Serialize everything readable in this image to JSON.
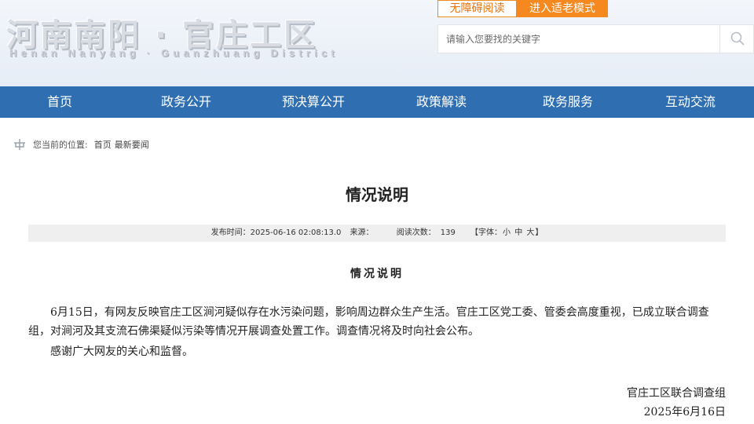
{
  "header": {
    "logo_cn": "河南南阳 · 官庄工区",
    "logo_en": "Henan Nanyang · Guanzhuang District",
    "accessibility_label": "无障碍阅读",
    "elder_mode_label": "进入适老模式",
    "search": {
      "placeholder": "请输入您要找的关键字"
    }
  },
  "nav": {
    "items": [
      {
        "label": "首页"
      },
      {
        "label": "政务公开"
      },
      {
        "label": "预决算公开"
      },
      {
        "label": "政策解读"
      },
      {
        "label": "政务服务"
      },
      {
        "label": "互动交流"
      }
    ]
  },
  "breadcrumb": {
    "prefix": "您当前的位置:",
    "items": [
      "首页",
      "最新要闻"
    ]
  },
  "article": {
    "title": "情况说明",
    "meta": {
      "publish_label": "发布时间：",
      "publish_time": "2025-06-16 02:08:13.0",
      "source_label": "来源：",
      "source": "",
      "views_label": "阅读次数：",
      "views": "139",
      "font_label_open": "【字体：",
      "font_small": "小",
      "font_medium": "中",
      "font_large": "大",
      "font_label_close": "】"
    },
    "subtitle": "情况说明",
    "paragraphs": [
      "6月15日，有网友反映官庄工区涧河疑似存在水污染问题，影响周边群众生产生活。官庄工区党工委、管委会高度重视，已成立联合调查组，对涧河及其支流石佛渠疑似污染等情况开展调查处置工作。调查情况将及时向社会公布。",
      "感谢广大网友的关心和监督。"
    ],
    "signature": "官庄工区联合调查组",
    "date": "2025年6月16日"
  },
  "colors": {
    "nav_bg": "#2f6fb1",
    "accent_orange": "#f5891f"
  }
}
